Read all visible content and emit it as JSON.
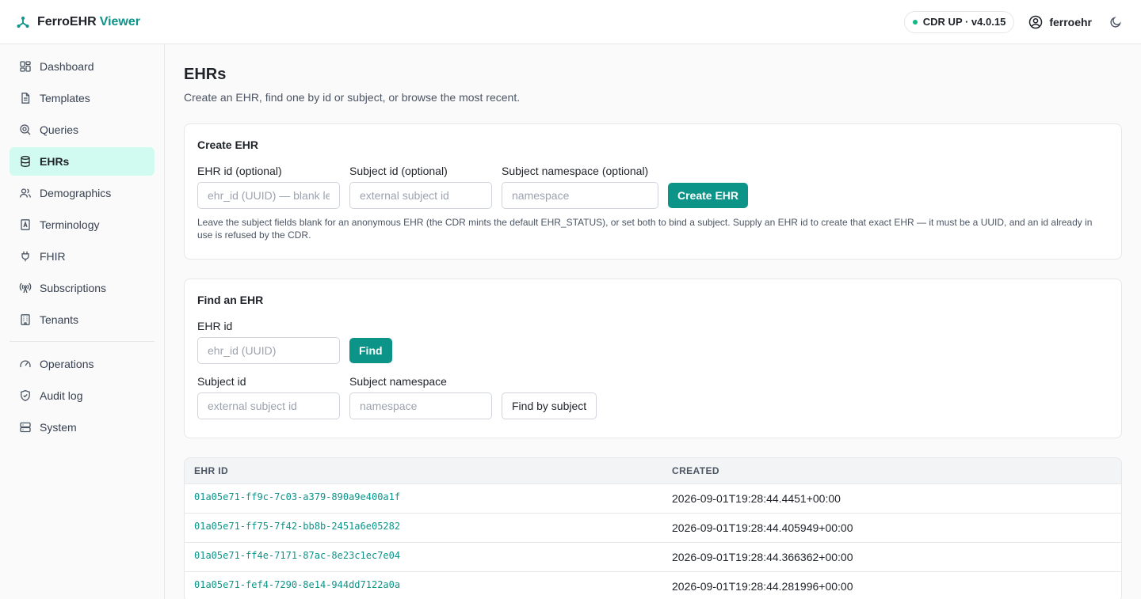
{
  "app": {
    "brand_name": "FerroEHR",
    "brand_accent": "Viewer",
    "status": "CDR UP · v4.0.15",
    "user": "ferroehr",
    "accent_color": "#0d9488"
  },
  "sidebar": {
    "items": [
      {
        "label": "Dashboard",
        "icon": "dashboard-icon"
      },
      {
        "label": "Templates",
        "icon": "file-icon"
      },
      {
        "label": "Queries",
        "icon": "search-icon"
      },
      {
        "label": "EHRs",
        "icon": "database-icon",
        "active": true
      },
      {
        "label": "Demographics",
        "icon": "users-icon"
      },
      {
        "label": "Terminology",
        "icon": "book-icon"
      },
      {
        "label": "FHIR",
        "icon": "plug-icon"
      },
      {
        "label": "Subscriptions",
        "icon": "broadcast-icon"
      },
      {
        "label": "Tenants",
        "icon": "building-icon"
      }
    ],
    "secondary": [
      {
        "label": "Operations",
        "icon": "gauge-icon"
      },
      {
        "label": "Audit log",
        "icon": "shield-icon"
      },
      {
        "label": "System",
        "icon": "server-icon"
      }
    ]
  },
  "page": {
    "title": "EHRs",
    "subtitle": "Create an EHR, find one by id or subject, or browse the most recent."
  },
  "create": {
    "title": "Create EHR",
    "ehr_id_label": "EHR id (optional)",
    "ehr_id_placeholder": "ehr_id (UUID) — blank lets the CDR pick",
    "subject_id_label": "Subject id (optional)",
    "subject_id_placeholder": "external subject id",
    "namespace_label": "Subject namespace (optional)",
    "namespace_placeholder": "namespace",
    "button": "Create EHR",
    "hint": "Leave the subject fields blank for an anonymous EHR (the CDR mints the default EHR_STATUS), or set both to bind a subject. Supply an EHR id to create that exact EHR — it must be a UUID, and an id already in use is refused by the CDR."
  },
  "find": {
    "title": "Find an EHR",
    "ehr_id_label": "EHR id",
    "ehr_id_placeholder": "ehr_id (UUID)",
    "find_button": "Find",
    "subject_id_label": "Subject id",
    "subject_id_placeholder": "external subject id",
    "namespace_label": "Subject namespace",
    "namespace_placeholder": "namespace",
    "subject_button": "Find by subject"
  },
  "table": {
    "columns": [
      "EHR ID",
      "CREATED"
    ],
    "rows": [
      {
        "id": "01a05e71-ff9c-7c03-a379-890a9e400a1f",
        "created": "2026-09-01T19:28:44.4451+00:00"
      },
      {
        "id": "01a05e71-ff75-7f42-bb8b-2451a6e05282",
        "created": "2026-09-01T19:28:44.405949+00:00"
      },
      {
        "id": "01a05e71-ff4e-7171-87ac-8e23c1ec7e04",
        "created": "2026-09-01T19:28:44.366362+00:00"
      },
      {
        "id": "01a05e71-fef4-7290-8e14-944dd7122a0a",
        "created": "2026-09-01T19:28:44.281996+00:00"
      }
    ]
  }
}
